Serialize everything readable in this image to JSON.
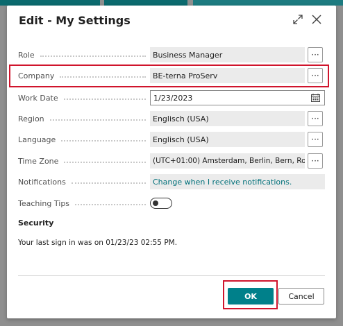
{
  "dialog": {
    "title": "Edit - My Settings",
    "expand_icon": "expand-diagonal-arrows-icon",
    "close_icon": "close-x-icon"
  },
  "fields": [
    {
      "label": "Role",
      "value": "Business Manager",
      "kind": "lookup"
    },
    {
      "label": "Company",
      "value": "BE-terna ProServ",
      "kind": "lookup"
    },
    {
      "label": "Work Date",
      "value": "1/23/2023",
      "kind": "date",
      "icon": "calendar-icon"
    },
    {
      "label": "Region",
      "value": "Englisch (USA)",
      "kind": "lookup"
    },
    {
      "label": "Language",
      "value": "Englisch (USA)",
      "kind": "lookup"
    },
    {
      "label": "Time Zone",
      "value": "(UTC+01:00) Amsterdam, Berlin, Bern, Ro...",
      "kind": "lookup"
    },
    {
      "label": "Notifications",
      "value": "Change when I receive notifications.",
      "kind": "link"
    },
    {
      "label": "Teaching Tips",
      "value": "off",
      "kind": "toggle"
    }
  ],
  "assist_button_label": "···",
  "security": {
    "heading": "Security",
    "last_sign_in": "Your last sign in was on 01/23/23 02:55 PM."
  },
  "buttons": {
    "ok": "OK",
    "cancel": "Cancel"
  },
  "colors": {
    "accent": "#00808a",
    "link": "#00707a",
    "highlight": "#d0142c",
    "field_bg": "#ebebeb"
  }
}
